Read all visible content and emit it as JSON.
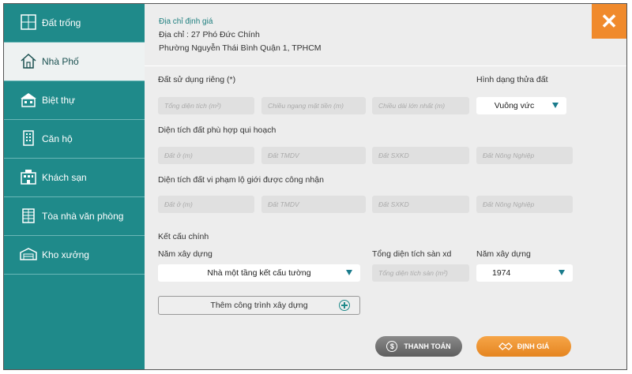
{
  "sidebar": {
    "items": [
      {
        "label": "Đất trống",
        "icon": "land-plot-icon"
      },
      {
        "label": "Nhà Phố",
        "icon": "house-icon"
      },
      {
        "label": "Biệt thự",
        "icon": "villa-icon"
      },
      {
        "label": "Căn hộ",
        "icon": "apartment-icon"
      },
      {
        "label": "Khách sạn",
        "icon": "hotel-icon"
      },
      {
        "label": "Tòa nhà văn phòng",
        "icon": "office-building-icon"
      },
      {
        "label": "Kho xưởng",
        "icon": "warehouse-icon"
      }
    ],
    "active_index": 1
  },
  "address": {
    "title": "Địa chỉ định giá",
    "line1": "Địa chỉ : 27 Phó Đức Chính",
    "line2": "Phường Nguyễn Thái Bình Quận 1, TPHCM"
  },
  "section1": {
    "label": "Đất sử dụng riêng (*)",
    "shape_label": "Hình dạng thửa đất",
    "fields": [
      "Tổng diện tích (m²)",
      "Chiều ngang mặt tiền (m)",
      "Chiều dài lớn nhất (m)"
    ],
    "shape_value": "Vuông vức"
  },
  "section2": {
    "label": "Diện tích đất phù hợp qui hoạch",
    "fields": [
      "Đất ở (m)",
      "Đất TMDV",
      "Đất SXKD",
      "Đất Nông Nghiệp"
    ]
  },
  "section3": {
    "label": "Diện tích đất vi phạm lộ giới được công nhận",
    "fields": [
      "Đất ở (m)",
      "Đất TMDV",
      "Đất SXKD",
      "Đất Nông Nghiệp"
    ]
  },
  "structure": {
    "title": "Kết cấu chính",
    "type_label": "Năm xây dựng",
    "type_value": "Nhà một tầng kết cấu tường",
    "area_label": "Tổng diện tích sàn xd",
    "area_placeholder": "Tổng diện tích sàn (m²)",
    "year_label": "Năm xây dựng",
    "year_value": "1974",
    "add_label": "Thêm công trình xây dựng"
  },
  "actions": {
    "pay_label": "THANH TOÁN",
    "price_label": "ĐỊNH GIÁ"
  },
  "colors": {
    "teal": "#1f8a8a",
    "orange": "#f08a2c"
  }
}
